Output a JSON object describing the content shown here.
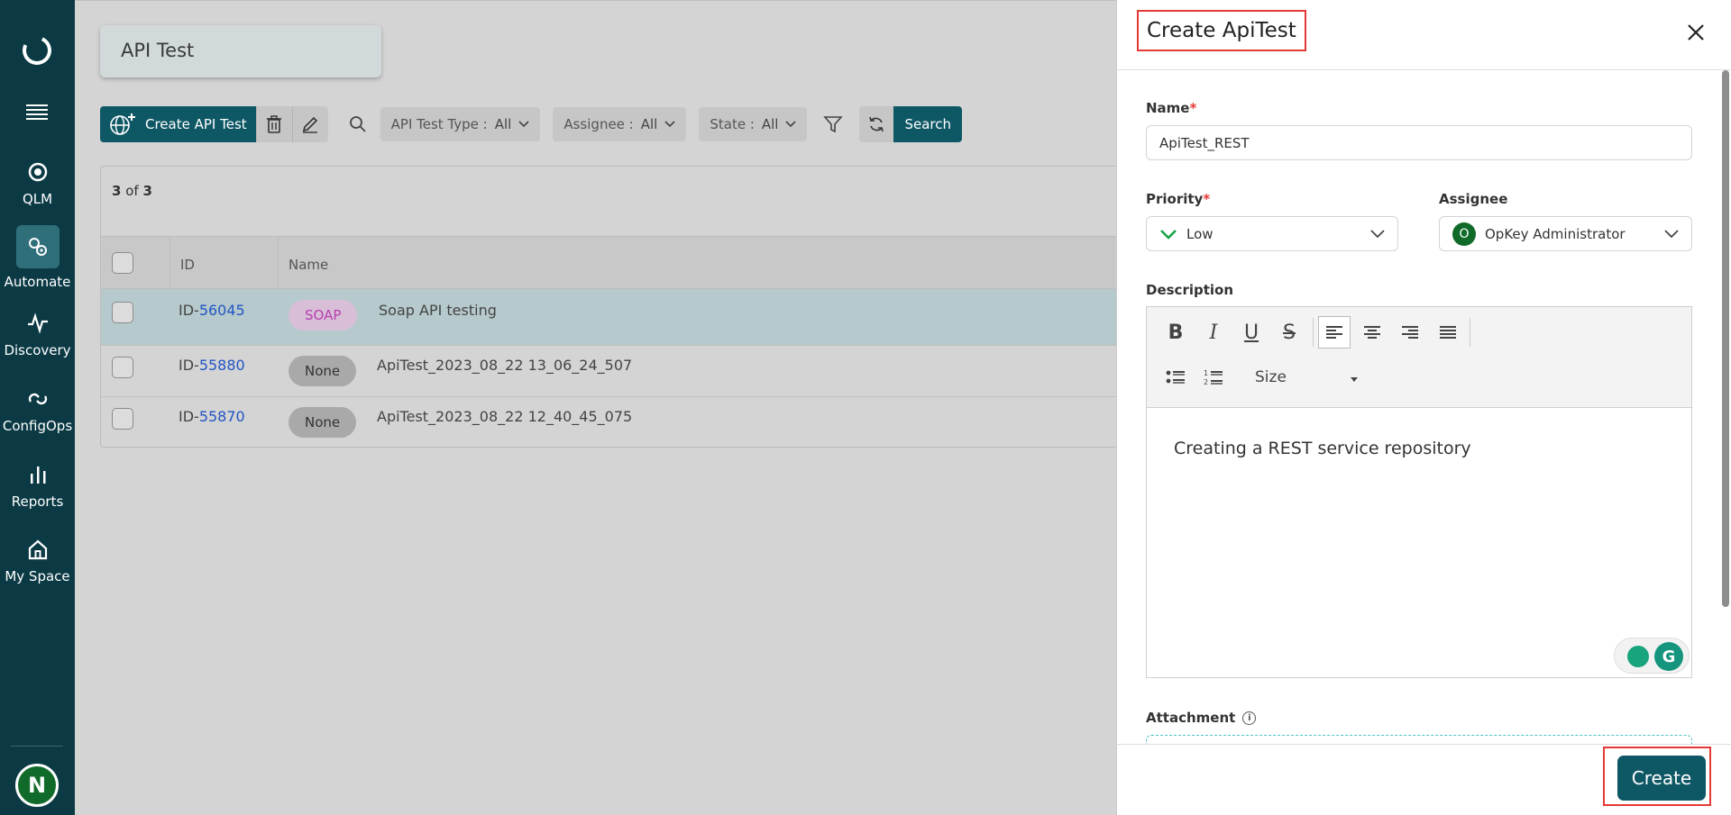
{
  "sidebar": {
    "items": [
      {
        "label": "QLM",
        "icon": "qlm-icon"
      },
      {
        "label": "Automate",
        "icon": "automate-icon"
      },
      {
        "label": "Discovery",
        "icon": "discovery-icon"
      },
      {
        "label": "ConfigOps",
        "icon": "configops-icon"
      },
      {
        "label": "Reports",
        "icon": "reports-icon"
      },
      {
        "label": "My Space",
        "icon": "home-icon"
      }
    ],
    "active": "Automate",
    "user_initial": "N"
  },
  "page": {
    "title": "API Test"
  },
  "toolbar": {
    "create_label": "Create API Test",
    "filters": [
      {
        "label": "API Test Type :",
        "value": "All"
      },
      {
        "label": "Assignee :",
        "value": "All"
      },
      {
        "label": "State :",
        "value": "All"
      }
    ],
    "search_label": "Search"
  },
  "grid": {
    "count_shown": "3",
    "count_of": "of",
    "count_total": "3",
    "columns": [
      "ID",
      "Name"
    ],
    "rows": [
      {
        "id_prefix": "ID-",
        "id": "56045",
        "type": "SOAP",
        "name": "Soap API testing",
        "selected": true
      },
      {
        "id_prefix": "ID-",
        "id": "55880",
        "type": "None",
        "name": "ApiTest_2023_08_22 13_06_24_507",
        "selected": false
      },
      {
        "id_prefix": "ID-",
        "id": "55870",
        "type": "None",
        "name": "ApiTest_2023_08_22 12_40_45_075",
        "selected": false
      }
    ]
  },
  "panel": {
    "title": "Create ApiTest",
    "name_label": "Name",
    "name_value": "ApiTest_REST",
    "priority_label": "Priority",
    "priority_value": "Low",
    "assignee_label": "Assignee",
    "assignee_initial": "O",
    "assignee_value": "OpKey Administrator",
    "description_label": "Description",
    "size_label": "Size",
    "description_value": "Creating a REST service repository",
    "attachment_label": "Attachment",
    "create_label": "Create",
    "required_mark": "*",
    "grammarly_letter": "G",
    "info_glyph": "i"
  },
  "colors": {
    "sidebar": "#0b3a45",
    "primary": "#0e5866",
    "highlight": "#e53935",
    "link": "#2155c4"
  }
}
